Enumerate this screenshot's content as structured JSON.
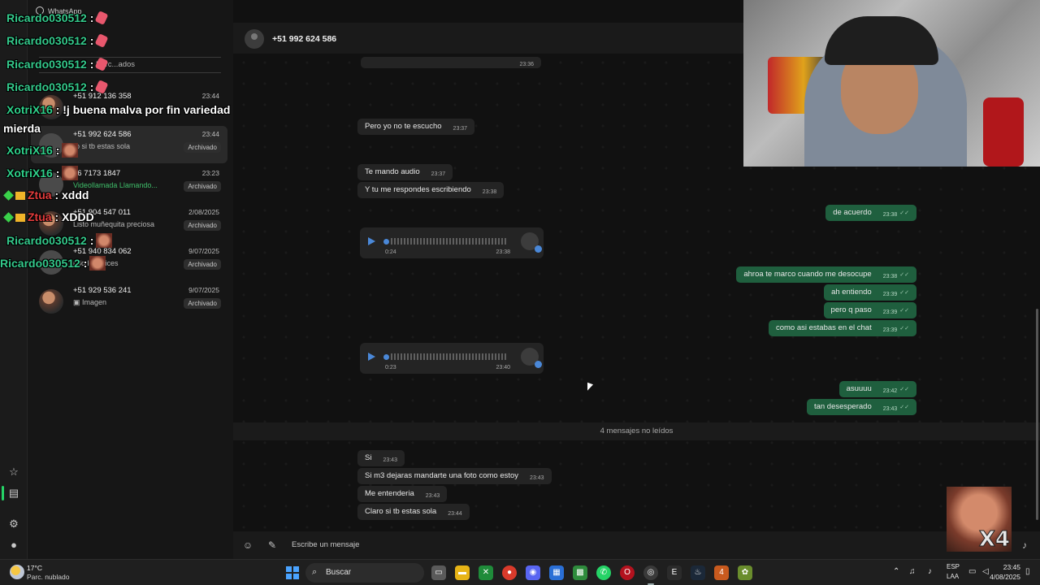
{
  "app": {
    "title": "WhatsApp"
  },
  "archived_header": "Parc...ados",
  "chats": [
    {
      "name": "+51 912 136 358",
      "time": "23:44",
      "preview": "",
      "badge": "Archivado"
    },
    {
      "name": "+51 992 624 586",
      "time": "23:44",
      "preview": "ro si tb estas sola",
      "badge": "Archivado"
    },
    {
      "name": "06 7173 1847",
      "time": "23:23",
      "preview": "Videollamada Llamando...",
      "badge": "Archivado"
    },
    {
      "name": "+51 904 547 011",
      "time": "2/08/2025",
      "preview": "Listo muñequita preciosa",
      "badge": "Archivado"
    },
    {
      "name": "+51 940 834 062",
      "time": "9/07/2025",
      "preview": "ndo lo q dices",
      "badge": "Archivado"
    },
    {
      "name": "+51 929 536 241",
      "time": "9/07/2025",
      "preview": "Imagen",
      "badge": "Archivado"
    }
  ],
  "conversation": {
    "contact": "+51 992 624 586",
    "top_time": "23:36",
    "messages_in": [
      {
        "text": "Pero yo no te escucho",
        "time": "23:37"
      },
      {
        "text": "Te mando audio",
        "time": "23:37"
      },
      {
        "text": "Y tu me respondes escribiendo",
        "time": "23:38"
      }
    ],
    "audio1": {
      "duration": "0:24",
      "time": "23:38"
    },
    "messages_out": [
      {
        "text": "de acuerdo",
        "time": "23:38"
      },
      {
        "text": "ahroa te marco cuando me desocupe",
        "time": "23:38"
      },
      {
        "text": "ah entiendo",
        "time": "23:39"
      },
      {
        "text": "pero q paso",
        "time": "23:39"
      },
      {
        "text": "como asi estabas en el chat",
        "time": "23:39"
      },
      {
        "text": "asuuuu",
        "time": "23:42"
      },
      {
        "text": "tan desesperado",
        "time": "23:43"
      }
    ],
    "audio2": {
      "duration": "0:23",
      "time": "23:40"
    },
    "unread_label": "4 mensajes no leídos",
    "messages_unread": [
      {
        "text": "Si",
        "time": "23:43"
      },
      {
        "text": "Si m3 dejaras mandarte una foto como estoy",
        "time": "23:43"
      },
      {
        "text": "Me entenderia",
        "time": "23:43"
      },
      {
        "text": "Claro si tb estas sola",
        "time": "23:44"
      }
    ],
    "composer_placeholder": "Escribe un mensaje"
  },
  "stream_chat": [
    {
      "user": "Ricardo030512",
      "msg": ""
    },
    {
      "user": "Ricardo030512",
      "msg": ""
    },
    {
      "user": "Ricardo030512",
      "msg": ""
    },
    {
      "user": "Ricardo030512",
      "msg": ""
    },
    {
      "user": "XotriX16",
      "msg": "!j buena malva por fin variedad"
    },
    {
      "user": "",
      "msg": "mierda"
    },
    {
      "user": "XotriX16",
      "msg": ""
    },
    {
      "user": "XotriX16",
      "msg": ""
    },
    {
      "user": "Ztua",
      "msg": "xddd"
    },
    {
      "user": "Ztua",
      "msg": "XDDD"
    },
    {
      "user": "Ricardo030512",
      "msg": ""
    },
    {
      "user": "Ricardo030512",
      "msg": ""
    }
  ],
  "emote_label": "X4",
  "taskbar": {
    "weather_temp": "17°C",
    "weather_desc": "Parc. nublado",
    "search_label": "Buscar",
    "lang1": "ESP",
    "lang2": "LAA",
    "time": "23:45",
    "date": "4/08/2025"
  },
  "colors": {
    "outgoing": "#1f5f3e",
    "incoming": "#242424",
    "accent": "#25d366"
  }
}
